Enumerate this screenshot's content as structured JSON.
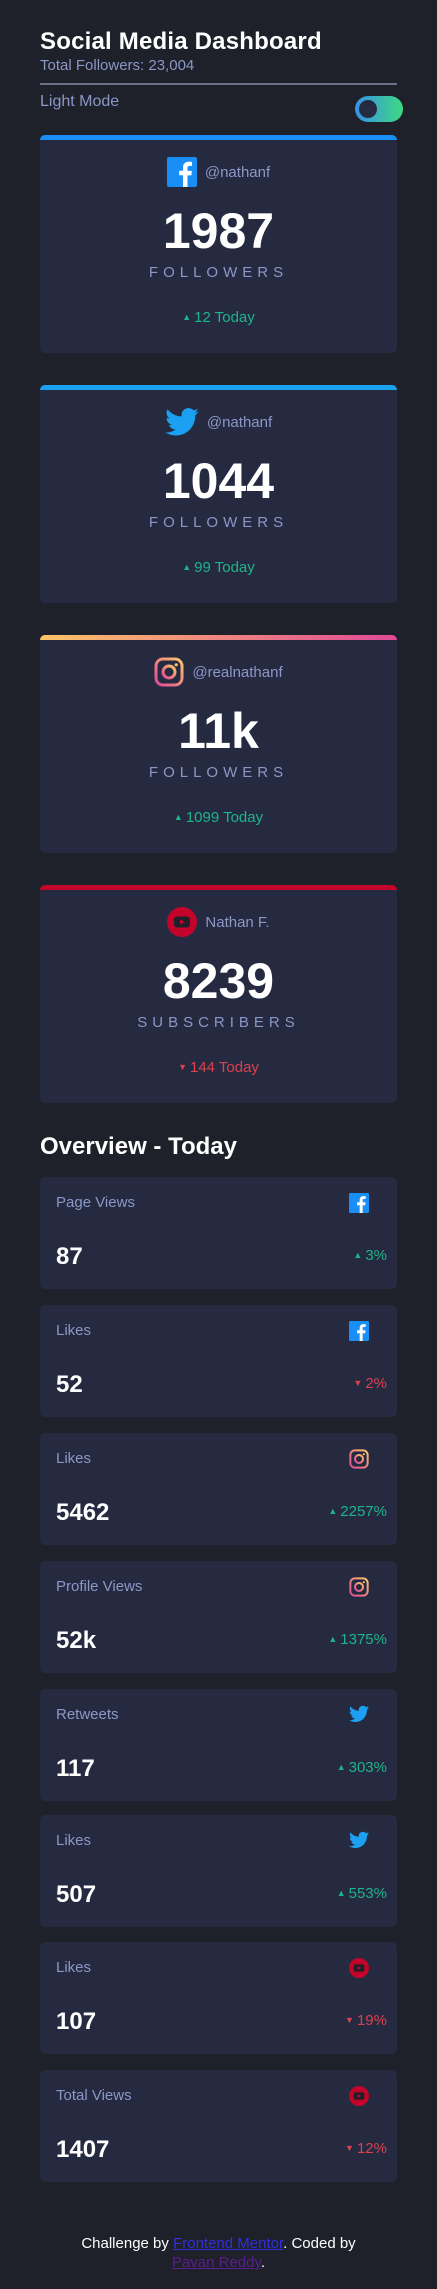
{
  "header": {
    "title": "Social Media Dashboard",
    "total_followers": "Total Followers: 23,004",
    "mode_label": "Light Mode"
  },
  "colors": {
    "background": "#1e202a",
    "card": "#252a41",
    "muted_text": "#8b97c6",
    "up": "#1db489",
    "down": "#dc414c",
    "facebook": "#198ff5",
    "twitter": "#1ca0f2",
    "instagram_start": "#fdc468",
    "instagram_end": "#df4996",
    "youtube": "#c4032a"
  },
  "cards": [
    {
      "platform": "facebook",
      "icon": "facebook-icon",
      "handle": "@nathanf",
      "count": "1987",
      "label": "FOLLOWERS",
      "today": "12 Today",
      "trend": "up"
    },
    {
      "platform": "twitter",
      "icon": "twitter-icon",
      "handle": "@nathanf",
      "count": "1044",
      "label": "FOLLOWERS",
      "today": "99 Today",
      "trend": "up"
    },
    {
      "platform": "instagram",
      "icon": "instagram-icon",
      "handle": "@realnathanf",
      "count": "11k",
      "label": "FOLLOWERS",
      "today": "1099 Today",
      "trend": "up"
    },
    {
      "platform": "youtube",
      "icon": "youtube-icon",
      "handle": "Nathan F.",
      "count": "8239",
      "label": "SUBSCRIBERS",
      "today": "144 Today",
      "trend": "down"
    }
  ],
  "overview": {
    "title": "Overview - Today",
    "items": [
      {
        "label": "Page Views",
        "icon": "facebook-icon",
        "value": "87",
        "change": "3%",
        "trend": "up"
      },
      {
        "label": "Likes",
        "icon": "facebook-icon",
        "value": "52",
        "change": "2%",
        "trend": "down"
      },
      {
        "label": "Likes",
        "icon": "instagram-icon",
        "value": "5462",
        "change": "2257%",
        "trend": "up"
      },
      {
        "label": "Profile Views",
        "icon": "instagram-icon",
        "value": "52k",
        "change": "1375%",
        "trend": "up"
      },
      {
        "label": "Retweets",
        "icon": "twitter-icon",
        "value": "117",
        "change": "303%",
        "trend": "up"
      },
      {
        "label": "Likes",
        "icon": "twitter-icon",
        "value": "507",
        "change": "553%",
        "trend": "up"
      },
      {
        "label": "Likes",
        "icon": "youtube-icon",
        "value": "107",
        "change": "19%",
        "trend": "down"
      },
      {
        "label": "Total Views",
        "icon": "youtube-icon",
        "value": "1407",
        "change": "12%",
        "trend": "down"
      }
    ]
  },
  "footer": {
    "prefix": "Challenge by ",
    "link1": "Frontend Mentor",
    "middle": ". Coded by ",
    "link2": "Pavan Reddy",
    "suffix": "."
  }
}
